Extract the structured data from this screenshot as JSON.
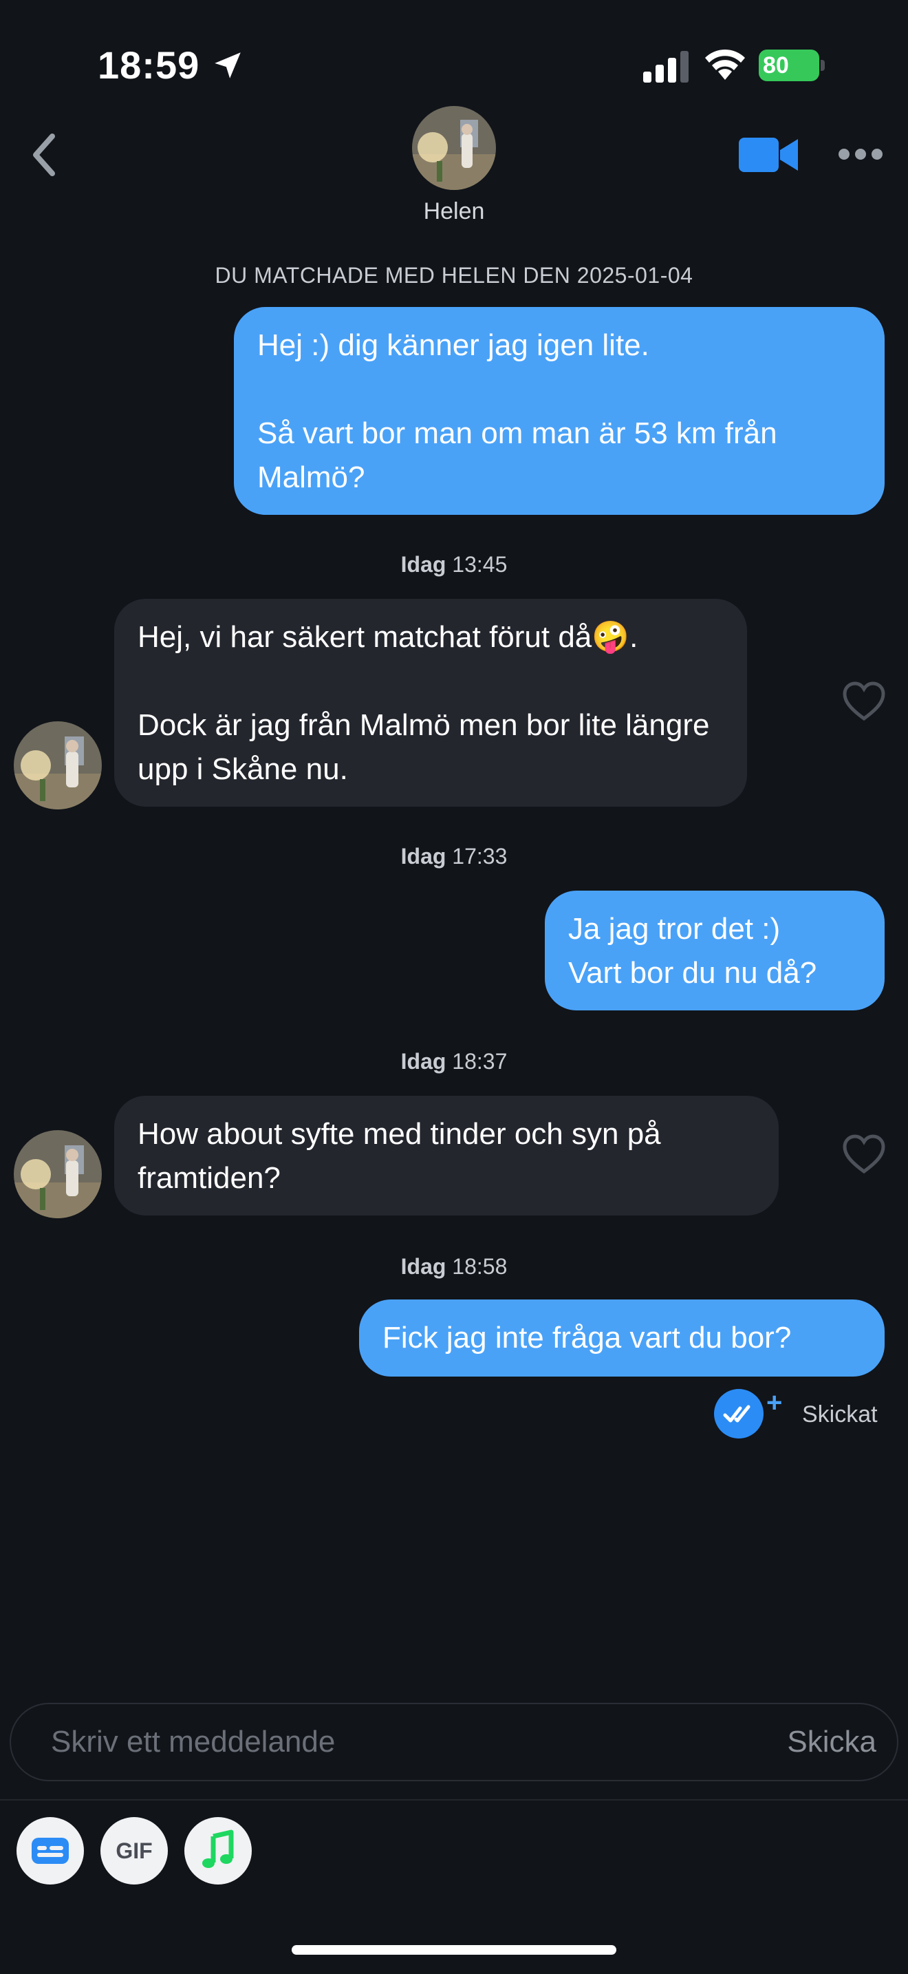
{
  "status_bar": {
    "time": "18:59",
    "battery": "80"
  },
  "header": {
    "name": "Helen"
  },
  "match_label": "DU MATCHADE MED HELEN DEN 2025-01-04",
  "messages": [
    {
      "text": "Hej :) dig känner jag igen lite.\n\nSå vart bor man om man är 53 km från Malmö?"
    },
    {
      "text": "Hej, vi har säkert matchat förut då🤪.\n\nDock är jag från Malmö men bor lite längre upp i Skåne nu."
    },
    {
      "text": "Ja jag tror det :)\nVart bor du nu då?"
    },
    {
      "text": "How about syfte med tinder och syn på framtiden?"
    },
    {
      "text": "Fick jag inte fråga vart du bor?"
    }
  ],
  "timestamps": [
    {
      "day": "Idag",
      "time": "13:45"
    },
    {
      "day": "Idag",
      "time": "17:33"
    },
    {
      "day": "Idag",
      "time": "18:37"
    },
    {
      "day": "Idag",
      "time": "18:58"
    }
  ],
  "delivery": {
    "plus": "+",
    "status": "Skickat"
  },
  "composer": {
    "placeholder": "Skriv ett meddelande",
    "send_label": "Skicka"
  },
  "tools": {
    "gif_label": "GIF"
  },
  "colors": {
    "background": "#111419",
    "outgoing": "#4aa2f7",
    "incoming": "#24262e",
    "accent": "#2b8cf5"
  }
}
